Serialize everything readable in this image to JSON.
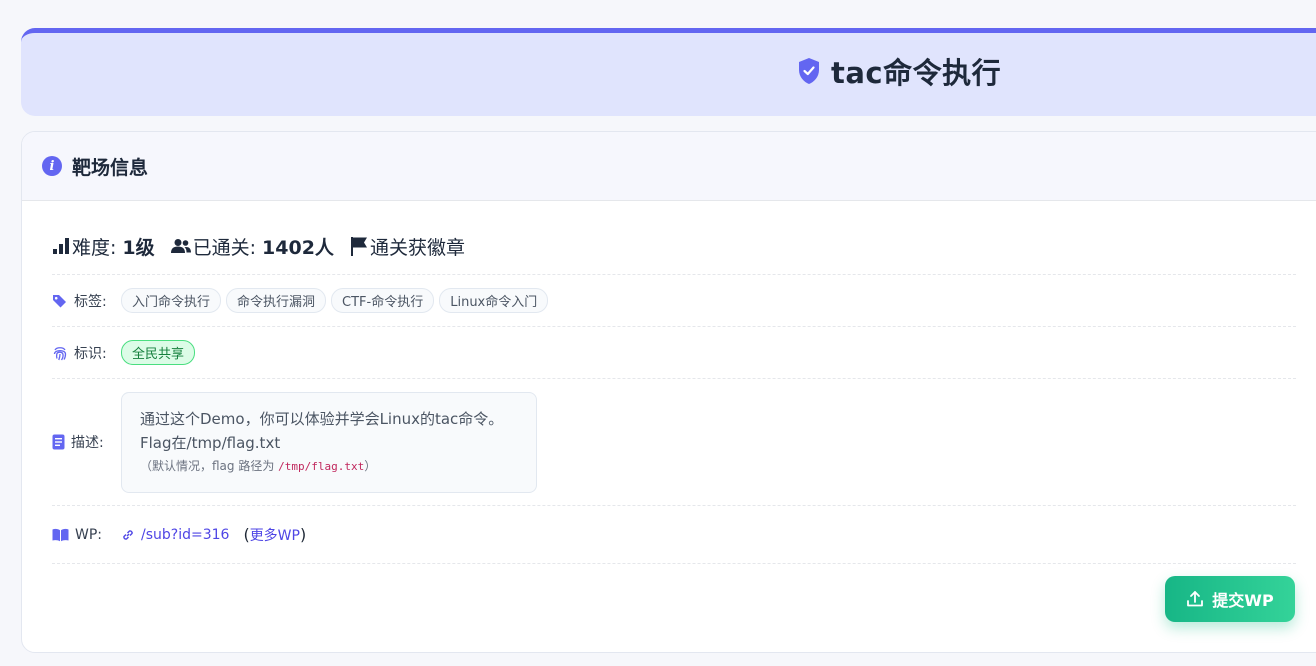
{
  "header": {
    "title": "tac命令执行"
  },
  "info": {
    "heading": "靶场信息",
    "difficulty_label": "难度:",
    "difficulty_value": "1级",
    "passed_label": "已通关:",
    "passed_value": "1402人",
    "badge_text": "通关获徽章",
    "tags_label": "标签:",
    "tags": [
      "入门命令执行",
      "命令执行漏洞",
      "CTF-命令执行",
      "Linux命令入门"
    ],
    "mark_label": "标识:",
    "mark_value": "全民共享",
    "desc_label": "描述:",
    "desc_line1": "通过这个Demo，你可以体验并学会Linux的tac命令。",
    "desc_line2": "Flag在/tmp/flag.txt",
    "desc_note_prefix": "（默认情况，flag 路径为 ",
    "desc_note_path": "/tmp/flag.txt",
    "desc_note_suffix": "）",
    "wp_label": "WP:",
    "wp_link": "/sub?id=316",
    "wp_more_open": "(",
    "wp_more_text": "更多WP",
    "wp_more_close": ")"
  },
  "actions": {
    "submit_wp": "提交WP"
  },
  "colors": {
    "accent": "#6366f1",
    "success": "#10b981",
    "title_bg": "#e0e4fd"
  }
}
